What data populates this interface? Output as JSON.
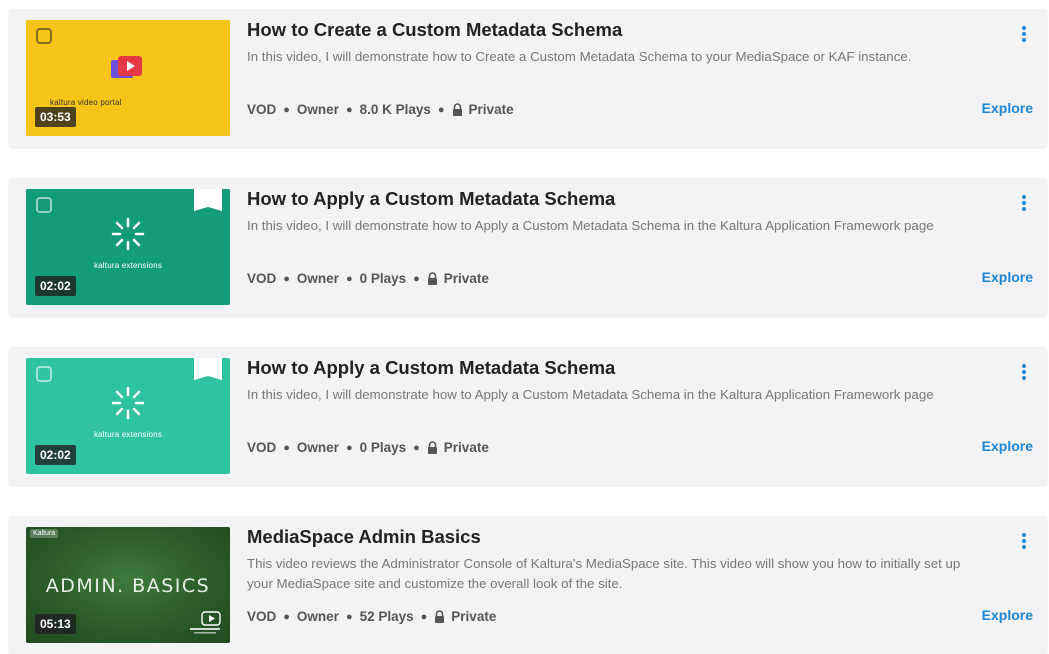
{
  "list": {
    "items": [
      {
        "title": "How to Create a Custom Metadata Schema",
        "description": "In this video, I will demonstrate how to Create a Custom Metadata Schema to your MediaSpace or KAF instance.",
        "duration": "03:53",
        "type": "VOD",
        "role": "Owner",
        "plays": "8.0 K Plays",
        "privacy": "Private",
        "action": "Explore",
        "thumbnail": {
          "caption": "kaltura video portal",
          "background": "#f5c518",
          "icon": "video-portal-play-icon"
        }
      },
      {
        "title": "How to Apply a Custom Metadata Schema",
        "description": "In this video, I will demonstrate how to Apply a Custom Metadata Schema in the Kaltura Application Framework page",
        "duration": "02:02",
        "type": "VOD",
        "role": "Owner",
        "plays": "0 Plays",
        "privacy": "Private",
        "action": "Explore",
        "thumbnail": {
          "caption": "kaltura extensions",
          "background": "#139c78",
          "icon": "spinner-icon"
        }
      },
      {
        "title": "How to Apply a Custom Metadata Schema",
        "description": "In this video, I will demonstrate how to Apply a Custom Metadata Schema in the Kaltura Application Framework page",
        "duration": "02:02",
        "type": "VOD",
        "role": "Owner",
        "plays": "0 Plays",
        "privacy": "Private",
        "action": "Explore",
        "thumbnail": {
          "caption": "kaltura extensions",
          "background": "#2fc3a0",
          "icon": "spinner-icon"
        }
      },
      {
        "title": "MediaSpace Admin Basics",
        "description": "This video reviews the Administrator Console of Kaltura's MediaSpace site. This video will show you how to initially set up your MediaSpace site and customize the overall look of the site.",
        "duration": "05:13",
        "type": "VOD",
        "role": "Owner",
        "plays": "52 Plays",
        "privacy": "Private",
        "action": "Explore",
        "thumbnail": {
          "caption": "ADMIN. BASICS",
          "badge": "Kaltura",
          "background": "#2b5c2a",
          "icon": "vod-training-icon"
        }
      }
    ]
  },
  "colors": {
    "accent": "#1d87d6",
    "card_bg": "#f3f3f5",
    "title": "#222222",
    "description": "#777777"
  }
}
